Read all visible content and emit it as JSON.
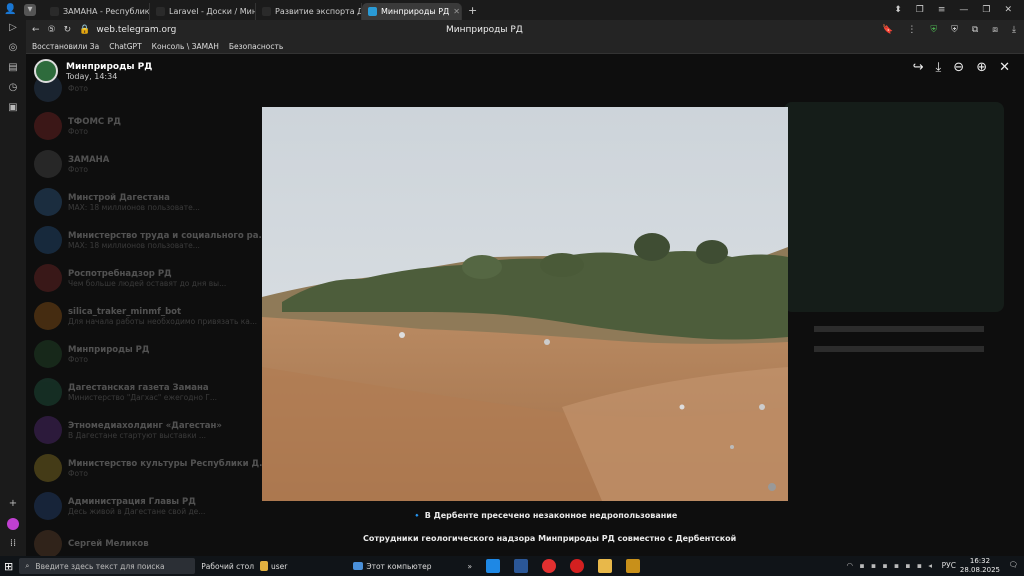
{
  "browser": {
    "tabs": [
      {
        "label": "ЗАМАНА - Республиканс",
        "active": false,
        "color": "#2a2a2a"
      },
      {
        "label": "Laravel - Доски / Минпс",
        "active": false,
        "color": "#2a2a2a"
      },
      {
        "label": "Развитие экспорта Дагес",
        "active": false,
        "color": "#2a2a2a"
      },
      {
        "label": "Минприроды РД",
        "active": true,
        "color": "#2a9bd6"
      }
    ],
    "url": "web.telegram.org",
    "page_title": "Минприроды РД",
    "bookmarks": [
      "Восстановили За",
      "ChatGPT",
      "Консоль \\ ЗАМАН",
      "Безопасность"
    ]
  },
  "telegram": {
    "viewer": {
      "channel_name": "Минприроды РД",
      "date": "Today, 14:34"
    },
    "chats": [
      {
        "name": "",
        "preview": "Фото",
        "color": "#3b5d8a"
      },
      {
        "name": "ТФОМС РД",
        "preview": "Фото",
        "color": "#b03030"
      },
      {
        "name": "ЗАМАНА",
        "preview": "Фото",
        "color": "#6a6a6a"
      },
      {
        "name": "Минстрой Дагестана",
        "preview": "МАХ: 18 миллионов пользовате...",
        "color": "#3e7dbf"
      },
      {
        "name": "Министерство труда и социального ра...",
        "preview": "МАХ: 18 миллионов пользовате...",
        "color": "#2f6fb5"
      },
      {
        "name": "Роспотребнадзор РД",
        "preview": "Чем больше людей оставят до дня вы...",
        "color": "#a83232"
      },
      {
        "name": "silica_traker_minmf_bot",
        "preview": "Для начала работы необходимо привязать ка...",
        "color": "#d27a1c"
      },
      {
        "name": "Минприроды РД",
        "preview": "Фото",
        "color": "#2e6b3c"
      },
      {
        "name": "Дагестанская газета Замана",
        "preview": "Министерство \"Дагхас\" ежегодно Г...",
        "color": "#2a7f5c"
      },
      {
        "name": "Этномедиахолдинг «Дагестан»",
        "preview": "В Дагестане стартуют выставки ...",
        "color": "#7a3ab0"
      },
      {
        "name": "Министерство культуры Республики Д...",
        "preview": "Фото",
        "color": "#cfb12e"
      },
      {
        "name": "Администрация Главы РД",
        "preview": "Десь живой в Дагестане свой де...",
        "color": "#2e5fa8"
      },
      {
        "name": "Сергей Меликов",
        "preview": "",
        "color": "#8a5a3a"
      }
    ],
    "caption_title": "🔹 В Дербенте пресечено незаконное недропользование",
    "caption_text": "Сотрудники геологического надзора Минприроды РД совместно с Дербентской"
  },
  "taskbar": {
    "search_placeholder": "Введите здесь текст для поиска",
    "desktop_label": "Рабочий стол",
    "user_label": "user",
    "computer_label": "Этот компьютер",
    "language": "РУС",
    "time": "16:32",
    "date": "28.08.2025"
  }
}
